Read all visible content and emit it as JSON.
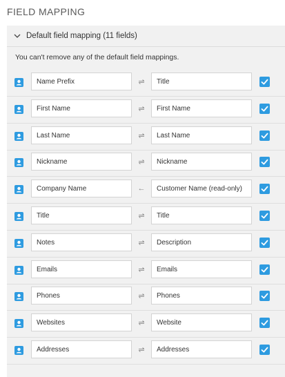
{
  "page": {
    "title": "FIELD MAPPING"
  },
  "section": {
    "header": "Default field mapping (11 fields)",
    "note": "You can't remove any of the default field mappings."
  },
  "colors": {
    "accent": "#2e9be0",
    "panel_bg": "#f1f1f1"
  },
  "icons": {
    "row_left": "contact-icon",
    "row_right": "checkbox-checked-icon",
    "section_toggle": "chevron-down-icon"
  },
  "mappings": [
    {
      "source": "Name Prefix",
      "arrow": "⇌",
      "target": "Title",
      "checked": true
    },
    {
      "source": "First Name",
      "arrow": "⇌",
      "target": "First Name",
      "checked": true
    },
    {
      "source": "Last Name",
      "arrow": "⇌",
      "target": "Last Name",
      "checked": true
    },
    {
      "source": "Nickname",
      "arrow": "⇌",
      "target": "Nickname",
      "checked": true
    },
    {
      "source": "Company Name",
      "arrow": "←",
      "target": "Customer Name (read-only)",
      "checked": true
    },
    {
      "source": "Title",
      "arrow": "⇌",
      "target": "Title",
      "checked": true
    },
    {
      "source": "Notes",
      "arrow": "⇌",
      "target": "Description",
      "checked": true
    },
    {
      "source": "Emails",
      "arrow": "⇌",
      "target": "Emails",
      "checked": true
    },
    {
      "source": "Phones",
      "arrow": "⇌",
      "target": "Phones",
      "checked": true
    },
    {
      "source": "Websites",
      "arrow": "⇌",
      "target": "Website",
      "checked": true
    },
    {
      "source": "Addresses",
      "arrow": "⇌",
      "target": "Addresses",
      "checked": true
    }
  ]
}
